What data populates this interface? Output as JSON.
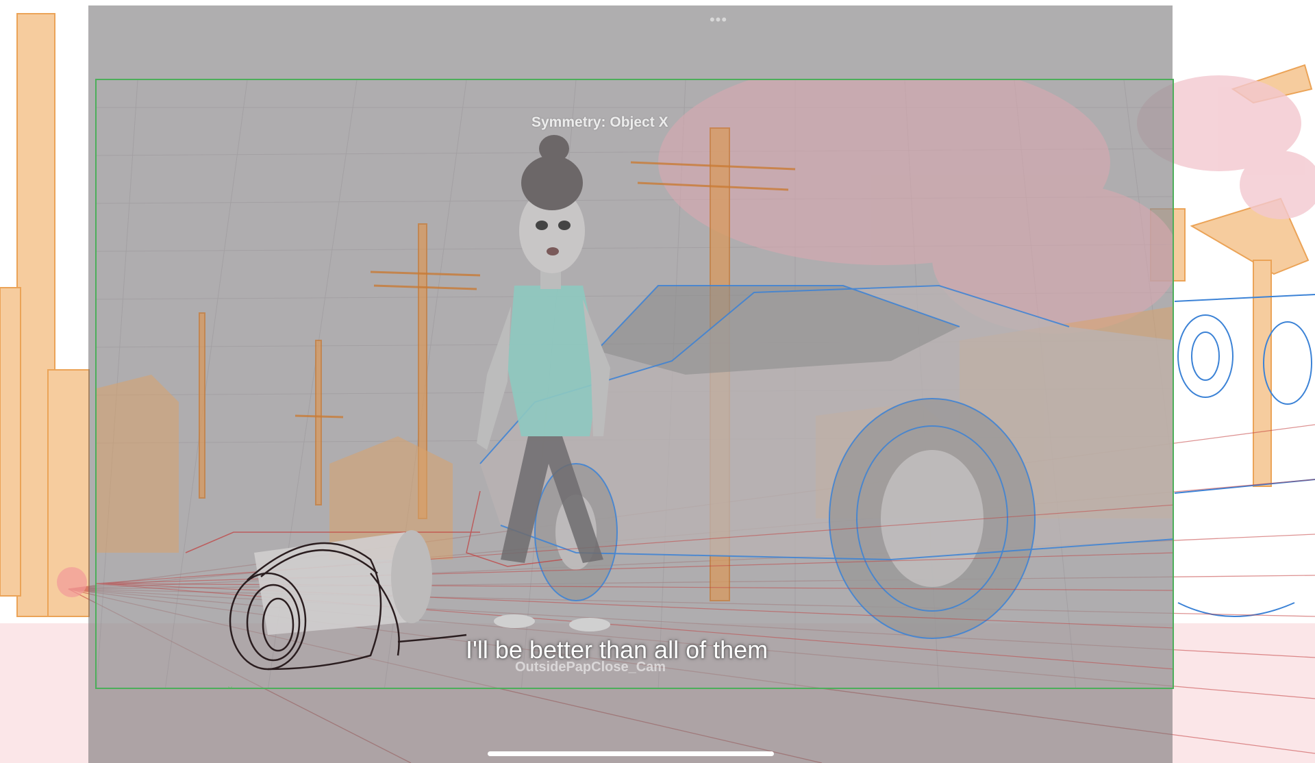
{
  "viewport": {
    "symmetry_label": "Symmetry: Object X",
    "subtitle": "I'll be better than all of them",
    "camera_name": "OutsidePapClose_Cam"
  },
  "icons": {
    "more": "more-dots-icon",
    "axis": "axis-gizmo-icon",
    "home": "home-indicator"
  },
  "colors": {
    "viewport_border": "#4cae5a",
    "sketch_orange": "#e8943a",
    "sketch_blue": "#3b82d6",
    "sketch_red": "#c23a3a",
    "character_shirt": "#8ec9c0"
  }
}
